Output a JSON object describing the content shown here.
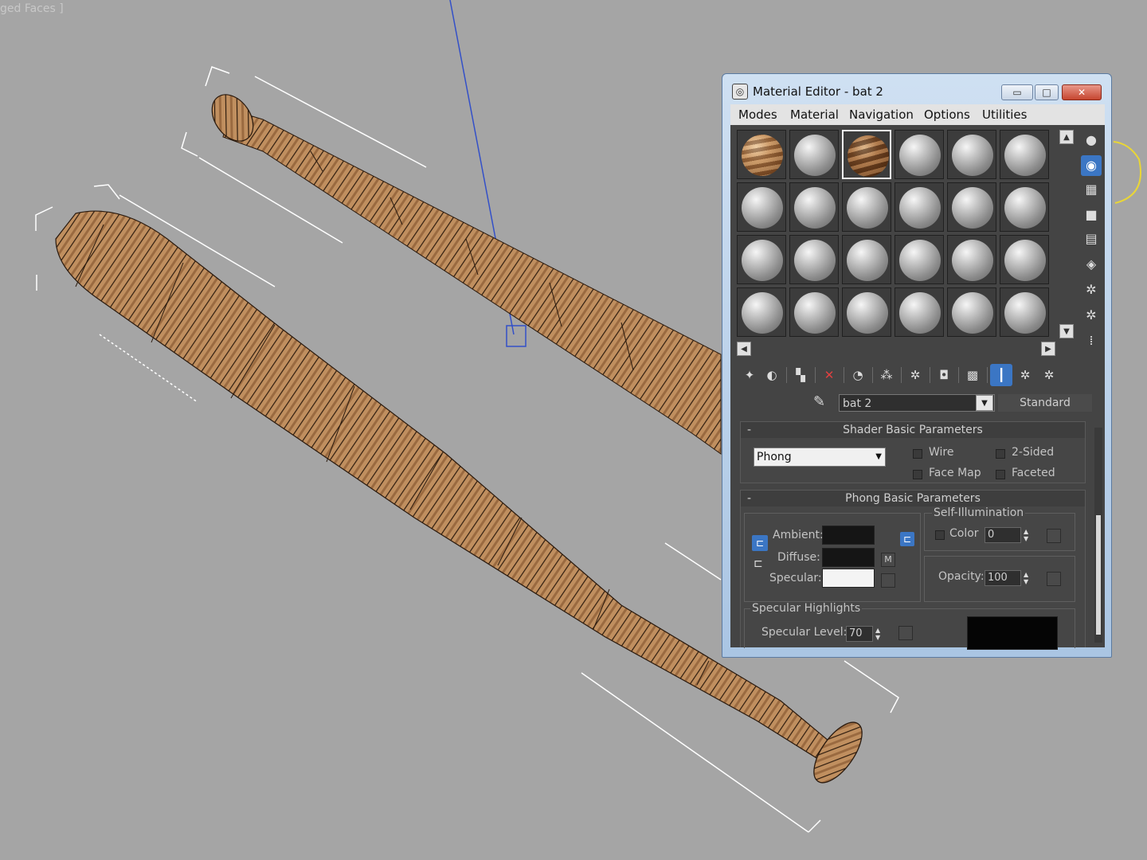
{
  "viewport": {
    "label": "ged Faces ]",
    "colors": {
      "background": "#a5a5a5",
      "wood_light": "#c89463",
      "wood_dark": "#8a5a33",
      "wire": "#2a1a0e"
    }
  },
  "material_editor": {
    "title": "Material Editor - bat 2",
    "window_buttons": {
      "minimize": "▭",
      "maximize": "□",
      "close": "✕"
    },
    "menu": [
      "Modes",
      "Material",
      "Navigation",
      "Options",
      "Utilities"
    ],
    "material_name": "bat 2",
    "material_type": "Standard",
    "sample_slots": [
      "wood",
      "plain",
      "wood-dark",
      "plain",
      "plain",
      "plain",
      "plain",
      "plain",
      "plain",
      "plain",
      "plain",
      "plain",
      "plain",
      "plain",
      "plain",
      "plain",
      "plain",
      "plain",
      "plain",
      "plain",
      "plain",
      "plain",
      "plain",
      "plain"
    ],
    "selected_slot": 3,
    "shader_rollout": {
      "title": "Shader Basic Parameters",
      "shader": "Phong",
      "checkboxes": {
        "wire": "Wire",
        "two_sided": "2-Sided",
        "face_map": "Face Map",
        "faceted": "Faceted"
      }
    },
    "phong_rollout": {
      "title": "Phong Basic Parameters",
      "ambient": "Ambient:",
      "diffuse": "Diffuse:",
      "specular": "Specular:",
      "map_button": "M",
      "self_illum_title": "Self-Illumination",
      "color_label": "Color",
      "color_value": "0",
      "opacity_label": "Opacity:",
      "opacity_value": "100",
      "specular_highlights": "Specular Highlights",
      "specular_level_label": "Specular Level:",
      "specular_level_value": "70",
      "swatch_colors": {
        "ambient": "#151515",
        "diffuse": "#151515",
        "specular": "#f4f4f4"
      }
    },
    "rollout_minus": "-"
  }
}
